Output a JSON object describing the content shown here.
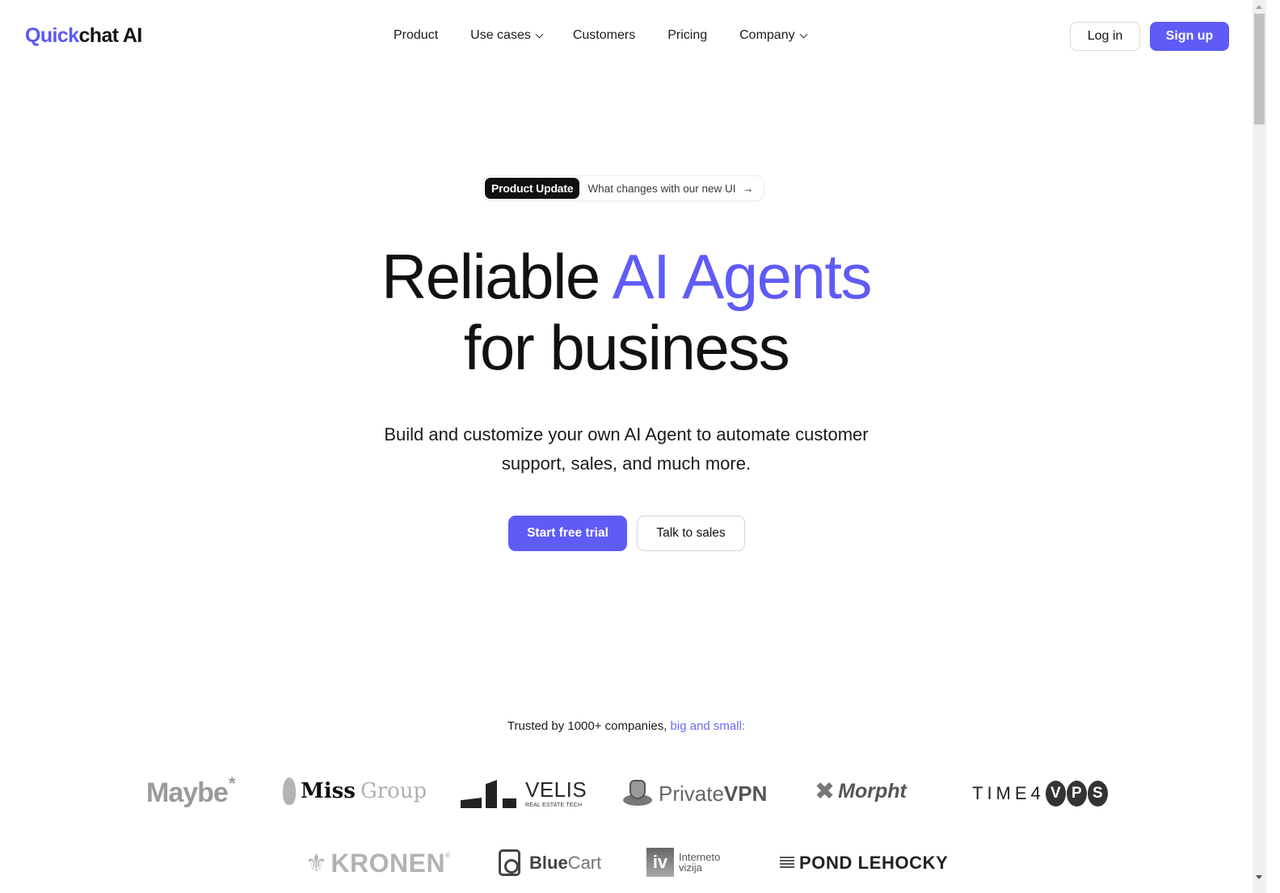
{
  "header": {
    "logo": {
      "part1": "Quick",
      "part2": "chat AI"
    },
    "nav": [
      {
        "label": "Product",
        "has_dropdown": false
      },
      {
        "label": "Use cases",
        "has_dropdown": true
      },
      {
        "label": "Customers",
        "has_dropdown": false
      },
      {
        "label": "Pricing",
        "has_dropdown": false
      },
      {
        "label": "Company",
        "has_dropdown": true
      }
    ],
    "login_label": "Log in",
    "signup_label": "Sign up"
  },
  "announcement": {
    "badge": "Product Update",
    "text": "What changes with our new UI",
    "arrow": "→"
  },
  "hero": {
    "headline_part1": "Reliable ",
    "headline_accent": "AI Agents",
    "headline_line2": "for business",
    "subtitle_line1": "Build and customize your own AI Agent to automate customer",
    "subtitle_line2": "support, sales, and much more.",
    "primary_cta": "Start free trial",
    "secondary_cta": "Talk to sales"
  },
  "trusted": {
    "text": "Trusted by 1000+ companies, ",
    "accent": "big and small:"
  },
  "customer_logos": {
    "maybe": {
      "name": "Maybe",
      "mark": "*"
    },
    "miss_group": {
      "bold": "Miss",
      "light": "Group"
    },
    "velis": {
      "name": "VELIS",
      "tagline": "REAL ESTATE TECH"
    },
    "privatevpn": {
      "light": "Private",
      "bold": "VPN"
    },
    "morpht": {
      "name": "Morpht",
      "mark": "✖"
    },
    "time4vps": {
      "prefix": "TIME4",
      "letters": [
        "V",
        "P",
        "S"
      ]
    },
    "kronen": {
      "name": "KRONEN",
      "mark": "⚜",
      "reg": "®"
    },
    "bluecart": {
      "bold": "Blue",
      "light": "Cart"
    },
    "internetovizija": {
      "line1": "Interneto",
      "line2": "vizija",
      "mark": "iv"
    },
    "pond_lehocky": {
      "name": "POND LEHOCKY"
    }
  },
  "colors": {
    "accent": "#5f5bf7",
    "text": "#111111",
    "badge_bg": "#111111"
  }
}
